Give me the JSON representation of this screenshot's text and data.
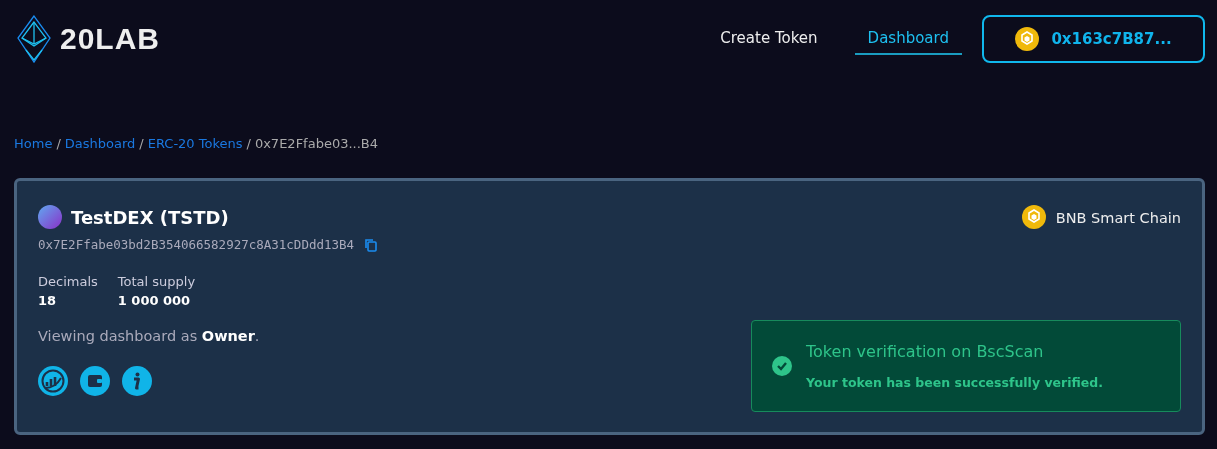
{
  "header": {
    "logo": "20LAB",
    "nav": [
      {
        "label": "Create Token",
        "selected": false
      },
      {
        "label": "Dashboard",
        "selected": true
      }
    ],
    "wallet": {
      "address": "0x163c7B87..."
    }
  },
  "breadcrumb": {
    "separator": "/",
    "items": [
      {
        "label": "Home",
        "link": true
      },
      {
        "label": "Dashboard",
        "link": true
      },
      {
        "label": "ERC-20 Tokens",
        "link": true
      },
      {
        "label": "0x7E2Ffabe03...B4",
        "link": false
      }
    ]
  },
  "token": {
    "name": "TestDEX (TSTD)",
    "address": "0x7E2Ffabe03bd2B354066582927c8A31cDDdd13B4",
    "network": "BNB Smart Chain",
    "stats": [
      {
        "label": "Decimals",
        "value": "18"
      },
      {
        "label": "Total supply",
        "value": "1 000 000"
      }
    ],
    "role_text": "Viewing dashboard as **Owner**.",
    "actions": [
      {
        "kind": "chart"
      },
      {
        "kind": "wallet"
      },
      {
        "kind": "info"
      }
    ],
    "alert": {
      "kind": "success",
      "title": "Token verification on BscScan",
      "message": "Your token has been successfully verified."
    }
  }
}
